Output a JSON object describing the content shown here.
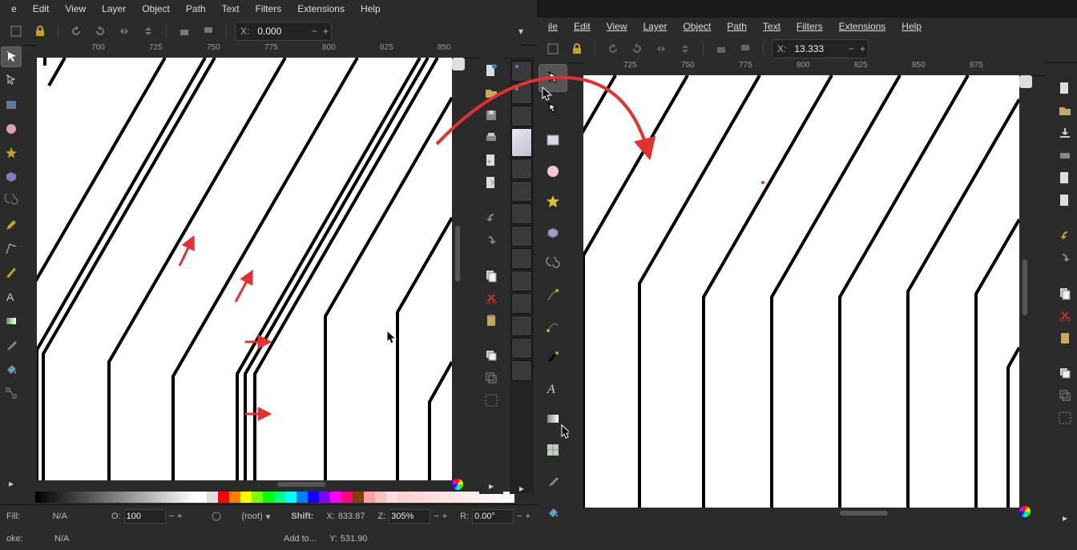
{
  "menus": [
    "e",
    "Edit",
    "View",
    "Layer",
    "Object",
    "Path",
    "Text",
    "Filters",
    "Extensions",
    "Help"
  ],
  "menus_right": [
    "ile",
    "Edit",
    "View",
    "Layer",
    "Object",
    "Path",
    "Text",
    "Filters",
    "Extensions",
    "Help"
  ],
  "toolbar_left": {
    "x_label": "X:",
    "x_value": "0.000"
  },
  "toolbar_right": {
    "x_label": "X:",
    "x_value": "13.333"
  },
  "ruler_ticks_left": [
    "700",
    "725",
    "750",
    "775",
    "800",
    "825",
    "850"
  ],
  "ruler_ticks_right": [
    "725",
    "750",
    "775",
    "800",
    "825",
    "850",
    "875"
  ],
  "palette": [
    "#ffffff",
    "#000000",
    "#ff0000",
    "#ffff00",
    "#00ff00",
    "#00ffff",
    "#0000ff",
    "#800080",
    "#ff00ff",
    "#663399",
    "#996633",
    "#ff6699",
    "#ffcccc",
    "#ffdddd"
  ],
  "status": {
    "fill_label": "Fill:",
    "fill_value": "N/A",
    "stroke_label": "oke:",
    "stroke_value": "N/A",
    "o_label": "O:",
    "o_value": "100",
    "root": "(root)",
    "shift_label": "Shift:",
    "addto": "Add to...",
    "x_label": "X:",
    "x_value": "833.87",
    "y_label": "Y:",
    "y_value": "531.90",
    "z_label": "Z:",
    "z_value": "305%",
    "r_label": "R:",
    "r_value": "0.00°"
  },
  "swatch_col": [
    {
      "c": "#3a3a3a",
      "mark": "blue"
    },
    {
      "c": "#d8c087"
    },
    {
      "c": "#3a3a3a"
    },
    {
      "c": "#d8d8d8",
      "grad": true
    },
    {
      "c": "#f2c6d0"
    },
    {
      "c": "#e0c030",
      "star": true
    },
    {
      "c": "#8a8ad0",
      "cube": true
    },
    {
      "c": "#3a3a3a",
      "spiral": true
    }
  ]
}
